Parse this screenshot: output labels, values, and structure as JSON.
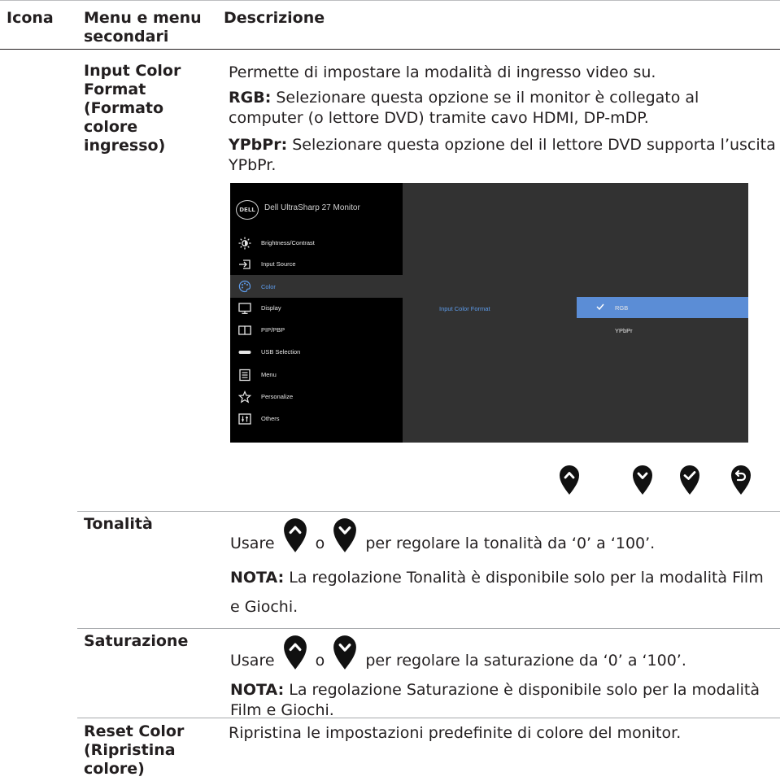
{
  "header": {
    "col_icon": "Icona",
    "col_menu": "Menu e menu secondari",
    "col_desc": "Descrizione"
  },
  "rows": {
    "input_color": {
      "name": "Input Color Format (Formato colore ingresso)",
      "intro": "Permette di impostare la modalità di ingresso video su.",
      "rgb_label": "RGB:",
      "rgb_text": "Selezionare questa opzione se il monitor è collegato al computer (o lettore DVD) tramite cavo HDMI, DP-mDP.",
      "ypbpr_label": "YPbPr:",
      "ypbpr_text": "Selezionare questa opzione del il lettore DVD supporta l’uscita YPbPr."
    },
    "hue": {
      "name": "Tonalità",
      "use": "Usare",
      "or": "o",
      "text": "per regolare la tonalità da ‘0’ a ‘100’.",
      "note_label": "NOTA:",
      "note_text": "La regolazione Tonalità è disponibile solo per la modalità Film e Giochi."
    },
    "saturation": {
      "name": "Saturazione",
      "use": "Usare",
      "or": "o",
      "text": "per regolare la saturazione da ‘0’ a ‘100’.",
      "note_label": "NOTA:",
      "note_text": "La regolazione Saturazione è disponibile solo per la modalità Film e Giochi."
    },
    "reset": {
      "name": "Reset Color (Ripristina colore)",
      "text": "Ripristina le impostazioni predefinite di colore del monitor."
    }
  },
  "osd": {
    "logo": "DELL",
    "title": "Dell UltraSharp 27 Monitor",
    "menu_items": [
      {
        "label": "Brightness/Contrast",
        "icon": "brightness-icon"
      },
      {
        "label": "Input Source",
        "icon": "input-source-icon"
      },
      {
        "label": "Color",
        "icon": "color-palette-icon",
        "selected": true
      },
      {
        "label": "Display",
        "icon": "display-icon"
      },
      {
        "label": "PIP/PBP",
        "icon": "pip-icon"
      },
      {
        "label": "USB Selection",
        "icon": "usb-icon"
      },
      {
        "label": "Menu",
        "icon": "menu-icon"
      },
      {
        "label": "Personalize",
        "icon": "star-icon"
      },
      {
        "label": "Others",
        "icon": "others-icon"
      }
    ],
    "submenu_label": "Input Color Format",
    "options": [
      {
        "label": "RGB",
        "selected": true
      },
      {
        "label": "YPbPr",
        "selected": false
      }
    ],
    "accent_color": "#5b8dd6",
    "nav_buttons": [
      "up-button-icon",
      "down-button-icon",
      "check-button-icon",
      "back-button-icon"
    ]
  }
}
